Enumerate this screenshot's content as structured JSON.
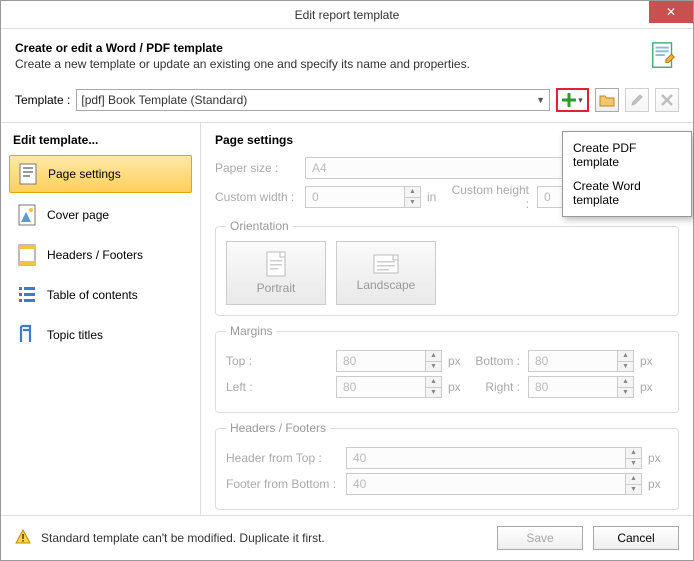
{
  "titlebar": {
    "title": "Edit report template"
  },
  "header": {
    "title": "Create or edit a Word / PDF template",
    "sub": "Create a new template or update an existing one and specify its name and properties."
  },
  "template": {
    "label": "Template :",
    "value": "[pdf] Book Template (Standard)"
  },
  "dropdown": {
    "item1": "Create PDF template",
    "item2": "Create Word template"
  },
  "sidebar": {
    "title": "Edit template...",
    "i0": "Page settings",
    "i1": "Cover page",
    "i2": "Headers / Footers",
    "i3": "Table of contents",
    "i4": "Topic titles"
  },
  "content": {
    "title": "Page settings",
    "paper_lbl": "Paper size :",
    "paper_val": "A4",
    "cw_lbl": "Custom width :",
    "cw_val": "0",
    "ch_lbl": "Custom height :",
    "ch_val": "0",
    "unit_in": "in",
    "orientation_lbl": "Orientation",
    "portrait": "Portrait",
    "landscape": "Landscape",
    "margins_lbl": "Margins",
    "top_lbl": "Top :",
    "top_val": "80",
    "bottom_lbl": "Bottom :",
    "bottom_val": "80",
    "left_lbl": "Left :",
    "left_val": "80",
    "right_lbl": "Right :",
    "right_val": "80",
    "unit_px": "px",
    "hf_lbl": "Headers / Footers",
    "hft_lbl": "Header from Top :",
    "hft_val": "40",
    "hfb_lbl": "Footer from Bottom :",
    "hfb_val": "40"
  },
  "footer": {
    "msg": "Standard template can't be modified. Duplicate it first.",
    "save": "Save",
    "cancel": "Cancel"
  }
}
